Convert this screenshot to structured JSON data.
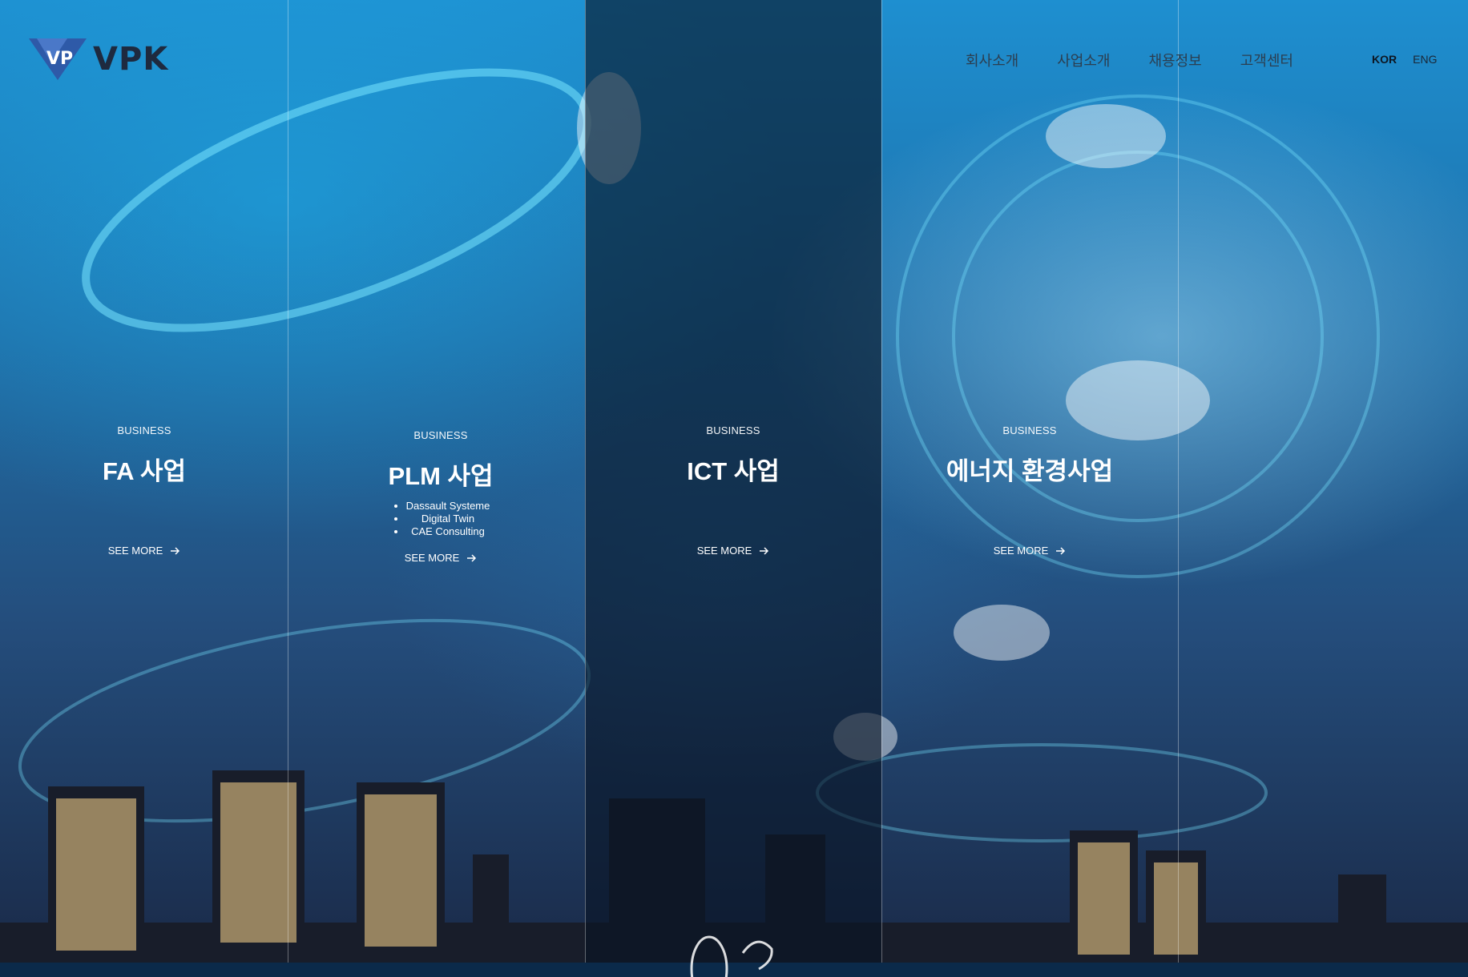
{
  "brand": {
    "name": "VPK",
    "logo_letters": "VP"
  },
  "nav": {
    "items": [
      "회사소개",
      "사업소개",
      "채용정보",
      "고객센터"
    ]
  },
  "lang": {
    "kor": "KOR",
    "eng": "ENG",
    "active": "KOR"
  },
  "panels": [
    {
      "kicker": "BUSINESS",
      "title": "FA 사업",
      "items": [],
      "more": "SEE MORE"
    },
    {
      "kicker": "BUSINESS",
      "title": "PLM 사업",
      "items": [
        "Dassault Systeme",
        "Digital Twin",
        "CAE Consulting"
      ],
      "more": "SEE MORE"
    },
    {
      "kicker": "BUSINESS",
      "title": "ICT 사업",
      "items": [],
      "more": "SEE MORE"
    },
    {
      "kicker": "BUSINESS",
      "title": "에너지 환경사업",
      "items": [],
      "more": "SEE MORE"
    }
  ],
  "colors": {
    "accent": "#1e8fd0",
    "logo_dark": "#1e2a3f",
    "logo_blue": "#2e5aa8"
  }
}
